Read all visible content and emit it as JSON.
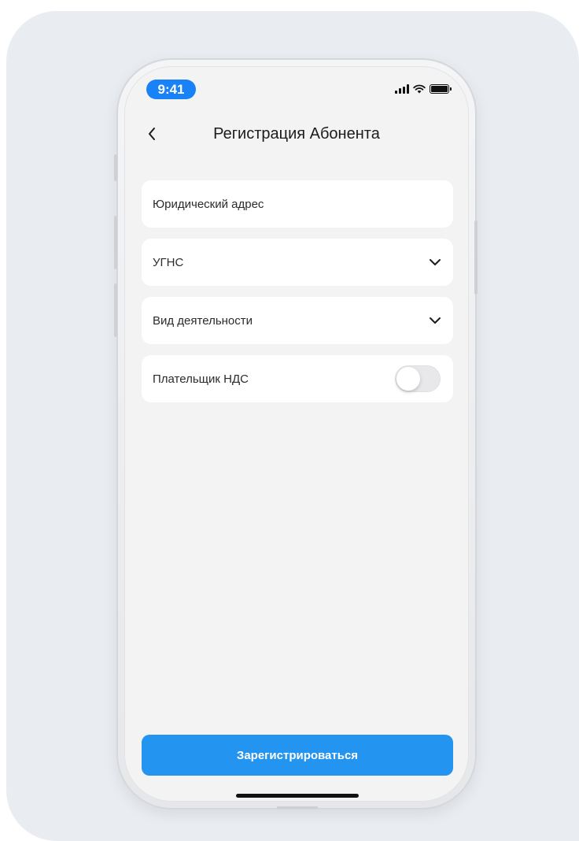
{
  "status_bar": {
    "time": "9:41",
    "icons": [
      "cellular-signal-icon",
      "wifi-icon",
      "battery-icon"
    ]
  },
  "header": {
    "back_icon": "chevron-left-icon",
    "title": "Регистрация Абонента"
  },
  "form": {
    "fields": [
      {
        "label": "Юридический адрес",
        "type": "text"
      },
      {
        "label": "УГНС",
        "type": "select",
        "icon": "chevron-down-icon"
      },
      {
        "label": "Вид деятельности",
        "type": "select",
        "icon": "chevron-down-icon"
      },
      {
        "label": "Плательщик НДС",
        "type": "toggle",
        "on": false
      }
    ]
  },
  "actions": {
    "submit_label": "Зарегистрироваться"
  },
  "colors": {
    "accent": "#2394ef",
    "time_pill": "#1a82f7",
    "screen_bg": "#f3f3f3",
    "card_bg": "#ffffff",
    "page_bg": "#e9ecf1"
  }
}
